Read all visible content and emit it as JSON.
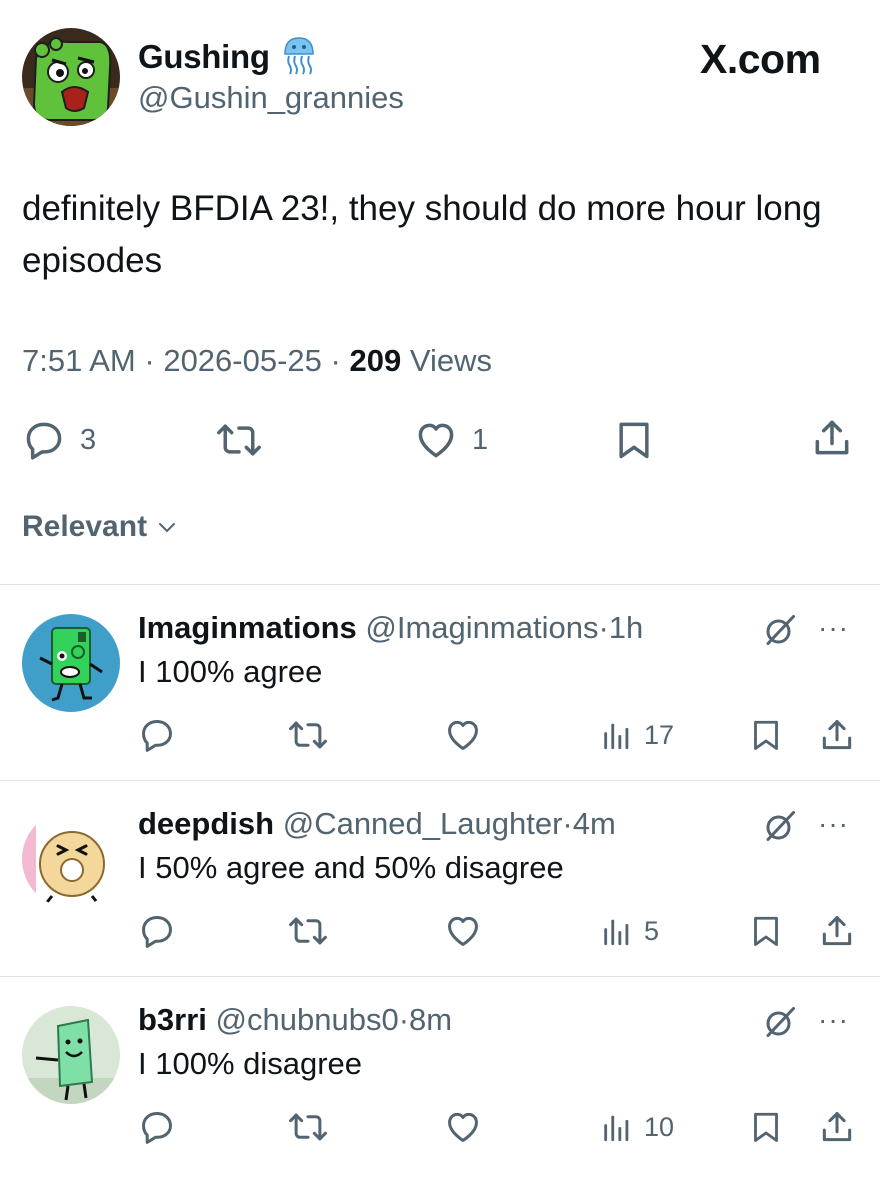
{
  "tweet": {
    "author_name": "Gushing",
    "author_handle": "@Gushin_grannies",
    "site_label": "X.com",
    "text": "definitely BFDIA 23!, they should do more hour long episodes",
    "time": "7:51 AM",
    "date": "2026-05-25",
    "views_count": "209",
    "views_label": "Views",
    "reply_count": "3",
    "like_count": "1",
    "badge_icon": "jellyfish-icon"
  },
  "sort": {
    "label": "Relevant",
    "icon": "chevron-down-icon"
  },
  "colors": {
    "text": "#0f1419",
    "secondary": "#536471",
    "divider": "#dfe3e6"
  },
  "replies": [
    {
      "name": "Imaginmations",
      "handle": "@Imaginmations",
      "time": "1h",
      "text": "I 100% agree",
      "views": "17"
    },
    {
      "name": "deepdish",
      "handle": "@Canned_Laughter",
      "time": "4m",
      "text": "I 50% agree and 50% disagree",
      "views": "5"
    },
    {
      "name": "b3rri",
      "handle": "@chubnubs0",
      "time": "8m",
      "text": "I 100% disagree",
      "views": "10"
    }
  ],
  "icons": [
    "reply-icon",
    "retweet-icon",
    "like-icon",
    "bookmark-icon",
    "share-icon",
    "views-icon",
    "grok-icon",
    "more-icon"
  ],
  "separator": "·",
  "more_glyph": "···"
}
